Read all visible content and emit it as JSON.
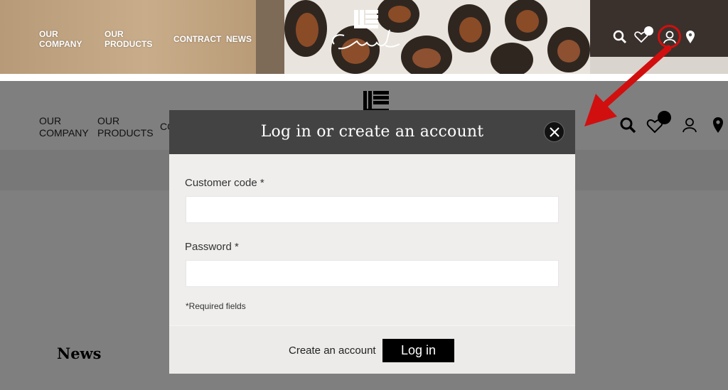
{
  "hero": {
    "nav": [
      {
        "label": "OUR COMPANY"
      },
      {
        "label": "OUR PRODUCTS"
      },
      {
        "label": "CONTRACT"
      },
      {
        "label": "NEWS"
      }
    ],
    "logo_text": "Casal",
    "icons": [
      "search-icon",
      "heart-icon",
      "user-icon",
      "location-pin-icon"
    ]
  },
  "page": {
    "nav": [
      {
        "label": "OUR COMPANY"
      },
      {
        "label": "OUR PRODUCTS"
      },
      {
        "label": "CO"
      }
    ],
    "news_heading": "News",
    "icons": [
      "search-icon",
      "heart-icon",
      "user-icon",
      "location-pin-icon"
    ]
  },
  "modal": {
    "title": "Log in or create an account",
    "customer_code_label": "Customer code *",
    "customer_code_value": "",
    "password_label": "Password *",
    "password_value": "",
    "required_note": "*Required fields",
    "create_account_label": "Create an account",
    "login_label": "Log in"
  },
  "colors": {
    "modal_header": "#434343",
    "modal_body": "#efeeed",
    "login_button": "#000000",
    "highlight": "#d10f0f"
  }
}
